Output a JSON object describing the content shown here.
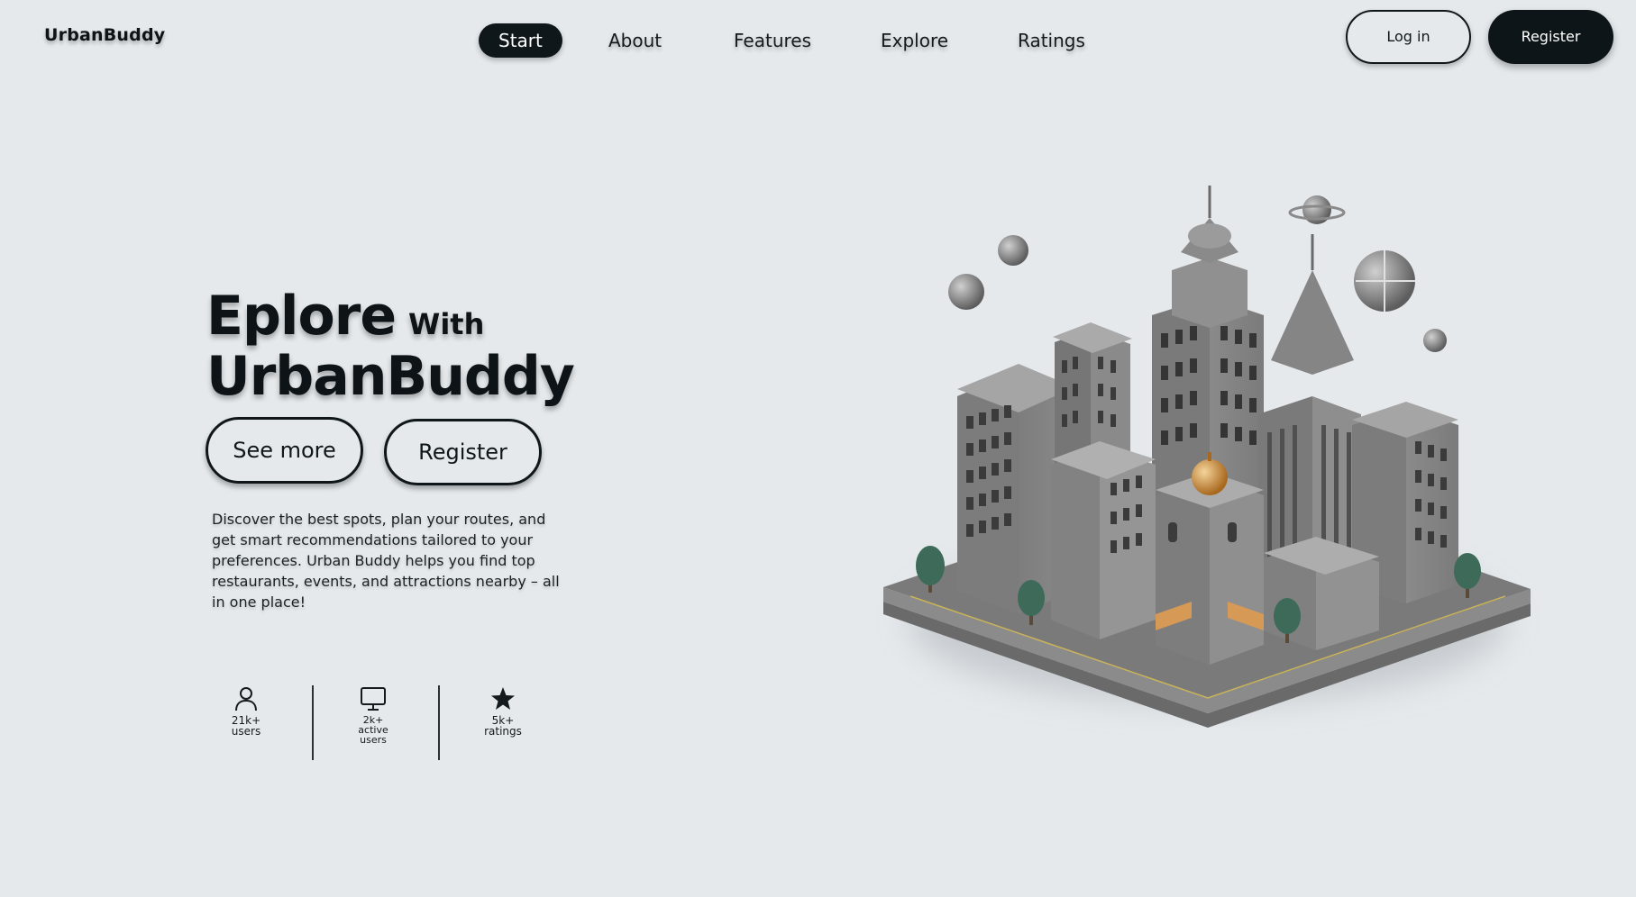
{
  "header": {
    "logo": "UrbanBuddy",
    "nav": [
      {
        "label": "Start",
        "active": true
      },
      {
        "label": "About"
      },
      {
        "label": "Features"
      },
      {
        "label": "Explore"
      },
      {
        "label": "Ratings"
      }
    ],
    "login_label": "Log in",
    "register_label": "Register"
  },
  "hero": {
    "title_line1_big": "Eplore",
    "title_line1_small": "With",
    "title_line2": "UrbanBuddy",
    "see_more_label": "See more",
    "register_label": "Register",
    "description": "Discover the best spots, plan your routes, and get smart recommendations tailored to your preferences. Urban Buddy helps you find top restaurants, events, and attractions nearby – all in one place!"
  },
  "stats": [
    {
      "icon": "user-icon",
      "label": "21k+\nusers"
    },
    {
      "icon": "monitor-icon",
      "label": "2k+\nactive\nusers"
    },
    {
      "icon": "star-icon",
      "label": "5k+\nratings"
    }
  ],
  "colors": {
    "background": "#e5e9ec",
    "primary_dark": "#0d1518",
    "text": "#0d1316"
  },
  "illustration": {
    "icon": "isometric-city-illustration"
  }
}
